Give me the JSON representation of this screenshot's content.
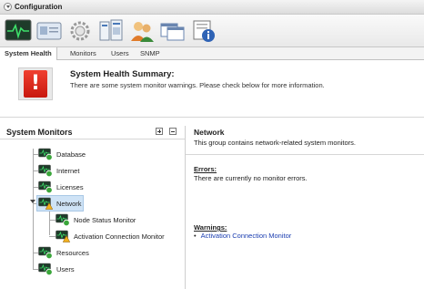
{
  "window": {
    "title": "Configuration"
  },
  "toolbar": {
    "icons": [
      "system-health-icon",
      "id-card-icon",
      "gear-icon",
      "monitors-icon",
      "users-icon",
      "windows-icon",
      "snmp-info-icon"
    ]
  },
  "tabs": [
    {
      "label": "System Health",
      "active": true
    },
    {
      "label": "Monitors",
      "active": false
    },
    {
      "label": "Users",
      "active": false
    },
    {
      "label": "SNMP",
      "active": false
    }
  ],
  "summary": {
    "icon_glyph": "!",
    "title": "System Health Summary:",
    "text": "There are some system monitor warnings. Please check below for more information."
  },
  "monitors_panel": {
    "title": "System Monitors",
    "expand_glyph": "+",
    "collapse_glyph": "−"
  },
  "tree": [
    {
      "label": "Database",
      "status": "ok",
      "level": 0
    },
    {
      "label": "Internet",
      "status": "ok",
      "level": 0
    },
    {
      "label": "Licenses",
      "status": "ok",
      "level": 0
    },
    {
      "label": "Network",
      "status": "warning",
      "level": 0,
      "selected": true
    },
    {
      "label": "Node Status Monitor",
      "status": "ok",
      "level": 1
    },
    {
      "label": "Activation Connection Monitor",
      "status": "warning",
      "level": 1
    },
    {
      "label": "Resources",
      "status": "ok",
      "level": 0
    },
    {
      "label": "Users",
      "status": "ok",
      "level": 0
    }
  ],
  "details": {
    "title": "Network",
    "description": "This group contains network-related system monitors.",
    "errors_heading": "Errors:",
    "errors_text": "There are currently no monitor errors.",
    "warnings_heading": "Warnings:",
    "warnings": [
      "Activation Connection Monitor"
    ]
  },
  "colors": {
    "ok": "#3aa63a",
    "warning": "#f2b01e",
    "error": "#d8261a",
    "link": "#1a3db0"
  }
}
